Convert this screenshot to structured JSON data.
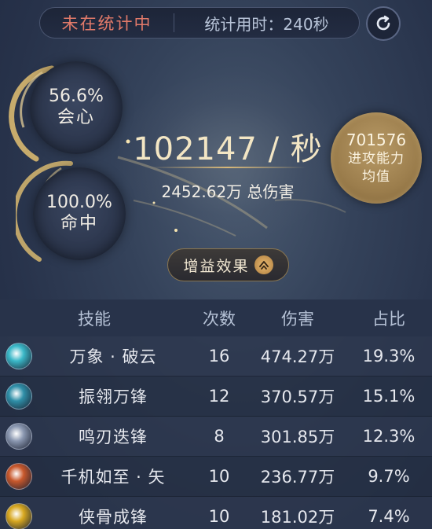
{
  "header": {
    "status": "未在统计中",
    "duration": "统计用时：240秒"
  },
  "stats": {
    "crit": {
      "value": "56.6%",
      "label": "会心"
    },
    "hit": {
      "value": "100.0%",
      "label": "命中"
    }
  },
  "dps": {
    "value": "102147 / 秒",
    "total": "2452.62万 总伤害"
  },
  "attack_avg": {
    "value": "701576",
    "label": "进攻能力均值"
  },
  "buff_button": {
    "label": "增益效果"
  },
  "table": {
    "headers": [
      "技能",
      "次数",
      "伤害",
      "占比"
    ],
    "rows": [
      {
        "name": "万象 · 破云",
        "count": "16",
        "damage": "474.27万",
        "percent": "19.3%",
        "icon": "swirl-skill-icon",
        "color": "#3ab8c8"
      },
      {
        "name": "振翎万锋",
        "count": "12",
        "damage": "370.57万",
        "percent": "15.1%",
        "icon": "archer-skill-icon",
        "color": "#2f8fa8"
      },
      {
        "name": "鸣刃迭锋",
        "count": "8",
        "damage": "301.85万",
        "percent": "12.3%",
        "icon": "blade-skill-icon",
        "color": "#8a97b0"
      },
      {
        "name": "千机如至 · 矢",
        "count": "10",
        "damage": "236.77万",
        "percent": "9.7%",
        "icon": "arrow-skill-icon",
        "color": "#c8582c"
      },
      {
        "name": "侠骨成锋",
        "count": "10",
        "damage": "181.02万",
        "percent": "7.4%",
        "icon": "flame-skill-icon",
        "color": "#d8a820"
      }
    ]
  },
  "colors": {
    "status_red": "#e27a6a",
    "gold": "#b89a66",
    "dps_text": "#f3e6c4"
  }
}
